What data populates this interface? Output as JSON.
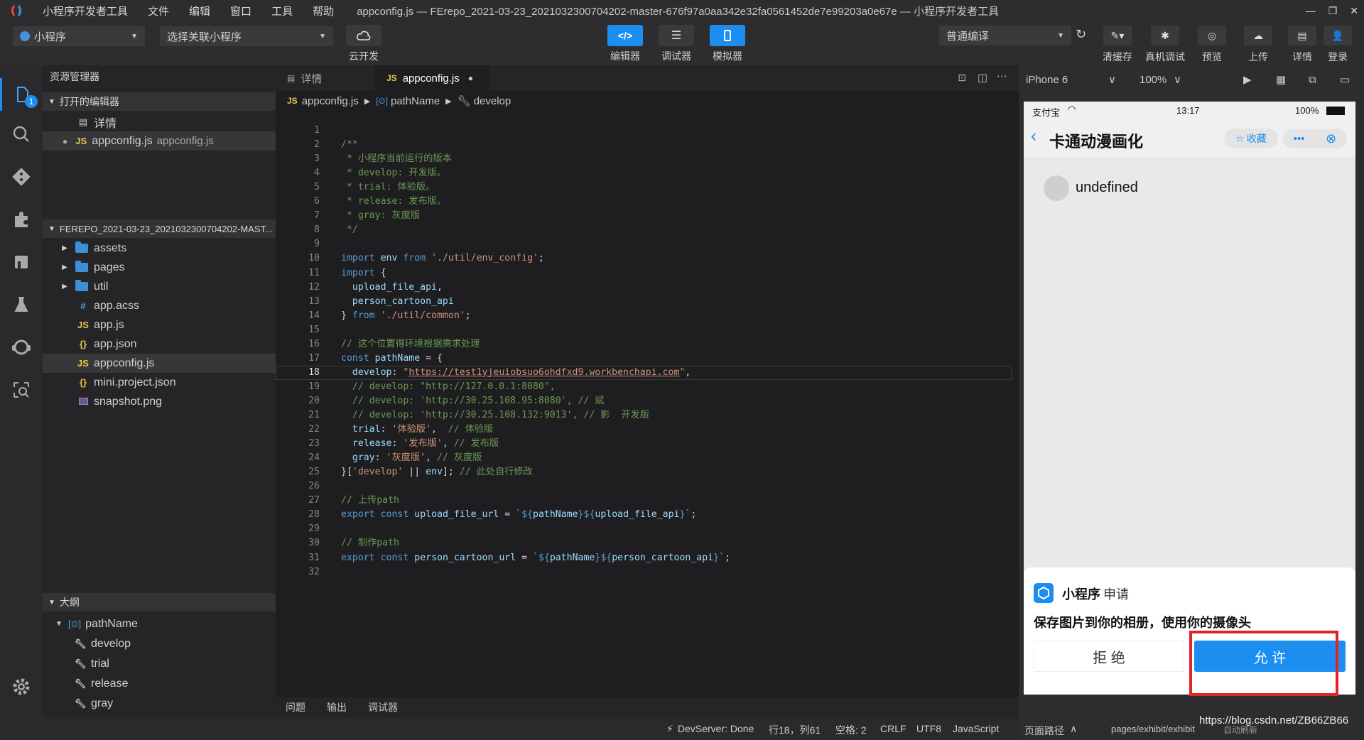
{
  "window": {
    "title": "appconfig.js — FErepo_2021-03-23_2021032300704202-master-676f97a0aa342e32fa0561452de7e99203a0e67e — 小程序开发者工具",
    "menu": [
      "小程序开发者工具",
      "文件",
      "编辑",
      "窗口",
      "工具",
      "帮助"
    ],
    "controls": [
      "—",
      "❐",
      "✕"
    ]
  },
  "toolbar": {
    "mode": "小程序",
    "project": "选择关联小程序",
    "cloud": "云开发",
    "center": [
      "编辑器",
      "调试器",
      "模拟器"
    ],
    "compile": "普通编译",
    "right": [
      "清缓存",
      "真机调试",
      "预览",
      "上传",
      "详情",
      "登录"
    ]
  },
  "activity": {
    "badge": "1"
  },
  "sidebar": {
    "title": "资源管理器",
    "open_editors": "打开的编辑器",
    "open_items": [
      {
        "label": "详情"
      },
      {
        "label": "appconfig.js",
        "hint": "appconfig.js"
      }
    ],
    "project": "FEREPO_2021-03-23_2021032300704202-MAST...",
    "folders": [
      "assets",
      "pages",
      "util"
    ],
    "files": [
      {
        "name": "app.acss",
        "icon": "#"
      },
      {
        "name": "app.js",
        "icon": "JS"
      },
      {
        "name": "app.json",
        "icon": "{}"
      },
      {
        "name": "appconfig.js",
        "icon": "JS"
      },
      {
        "name": "mini.project.json",
        "icon": "{}"
      },
      {
        "name": "snapshot.png",
        "icon": "img"
      }
    ],
    "outline": "大纲",
    "outline_root": "pathName",
    "outline_items": [
      "develop",
      "trial",
      "release",
      "gray"
    ]
  },
  "tabs": [
    {
      "label": "详情"
    },
    {
      "label": "appconfig.js"
    }
  ],
  "crumbs": {
    "file": "appconfig.js",
    "a": "pathName",
    "b": "develop"
  },
  "code_lines": [
    "",
    "/**",
    " * 小程序当前运行的版本",
    " * develop: 开发版。",
    " * trial: 体验版。",
    " * release: 发布版。",
    " * gray: 灰度版",
    " */",
    "",
    "import env from './util/env_config';",
    "import {",
    "  upload_file_api,",
    "  person_cartoon_api",
    "} from './util/common';",
    "",
    "// 这个位置得环境根据需求处理",
    "const pathName = {",
    "  develop: \"https://test1yjeuiobsuo6ohdfxd9.workbenchapi.com\",",
    "  // develop: \"http://127.0.0.1:8080\",",
    "  // develop: 'http://30.25.108.95:8080', // 斌",
    "  // develop: 'http://30.25.108.132:9013', // 影  开发版",
    "  trial: '体验版',  // 体验版",
    "  release: '发布版', // 发布版",
    "  gray: '灰度版', // 灰度版",
    "}['develop' || env]; // 此处自行修改",
    "",
    "// 上传path",
    "export const upload_file_url = `${pathName}${upload_file_api}`;",
    "",
    "// 制作path",
    "export const person_cartoon_url = `${pathName}${person_cartoon_api}`;",
    ""
  ],
  "current_line": 18,
  "panel": [
    "问题",
    "输出",
    "调试器"
  ],
  "status": {
    "dev": "DevServer: Done",
    "pos": "行18，列61",
    "space": "空格: 2",
    "eol": "CRLF",
    "enc": "UTF8",
    "lang": "JavaScript",
    "route": "页面路径",
    "path": "pages/exhibit/exhibit",
    "url": "https://blog.csdn.net/ZB66ZB66",
    "auto": "自动刷新"
  },
  "sim": {
    "device": "iPhone 6",
    "zoom": "100%"
  },
  "phone": {
    "carrier": "支付宝",
    "time": "13:17",
    "battery": "100%",
    "nav_title": "卡通动漫画化",
    "fav": "收藏",
    "content": "undefined",
    "dialog": {
      "app": "小程序",
      "req": "申请",
      "text": "保存图片到你的相册，使用你的摄像头",
      "reject": "拒 绝",
      "allow": "允 许"
    }
  },
  "colors": {
    "accent": "#1b8ef0",
    "highlight_box": "#e0242b"
  }
}
